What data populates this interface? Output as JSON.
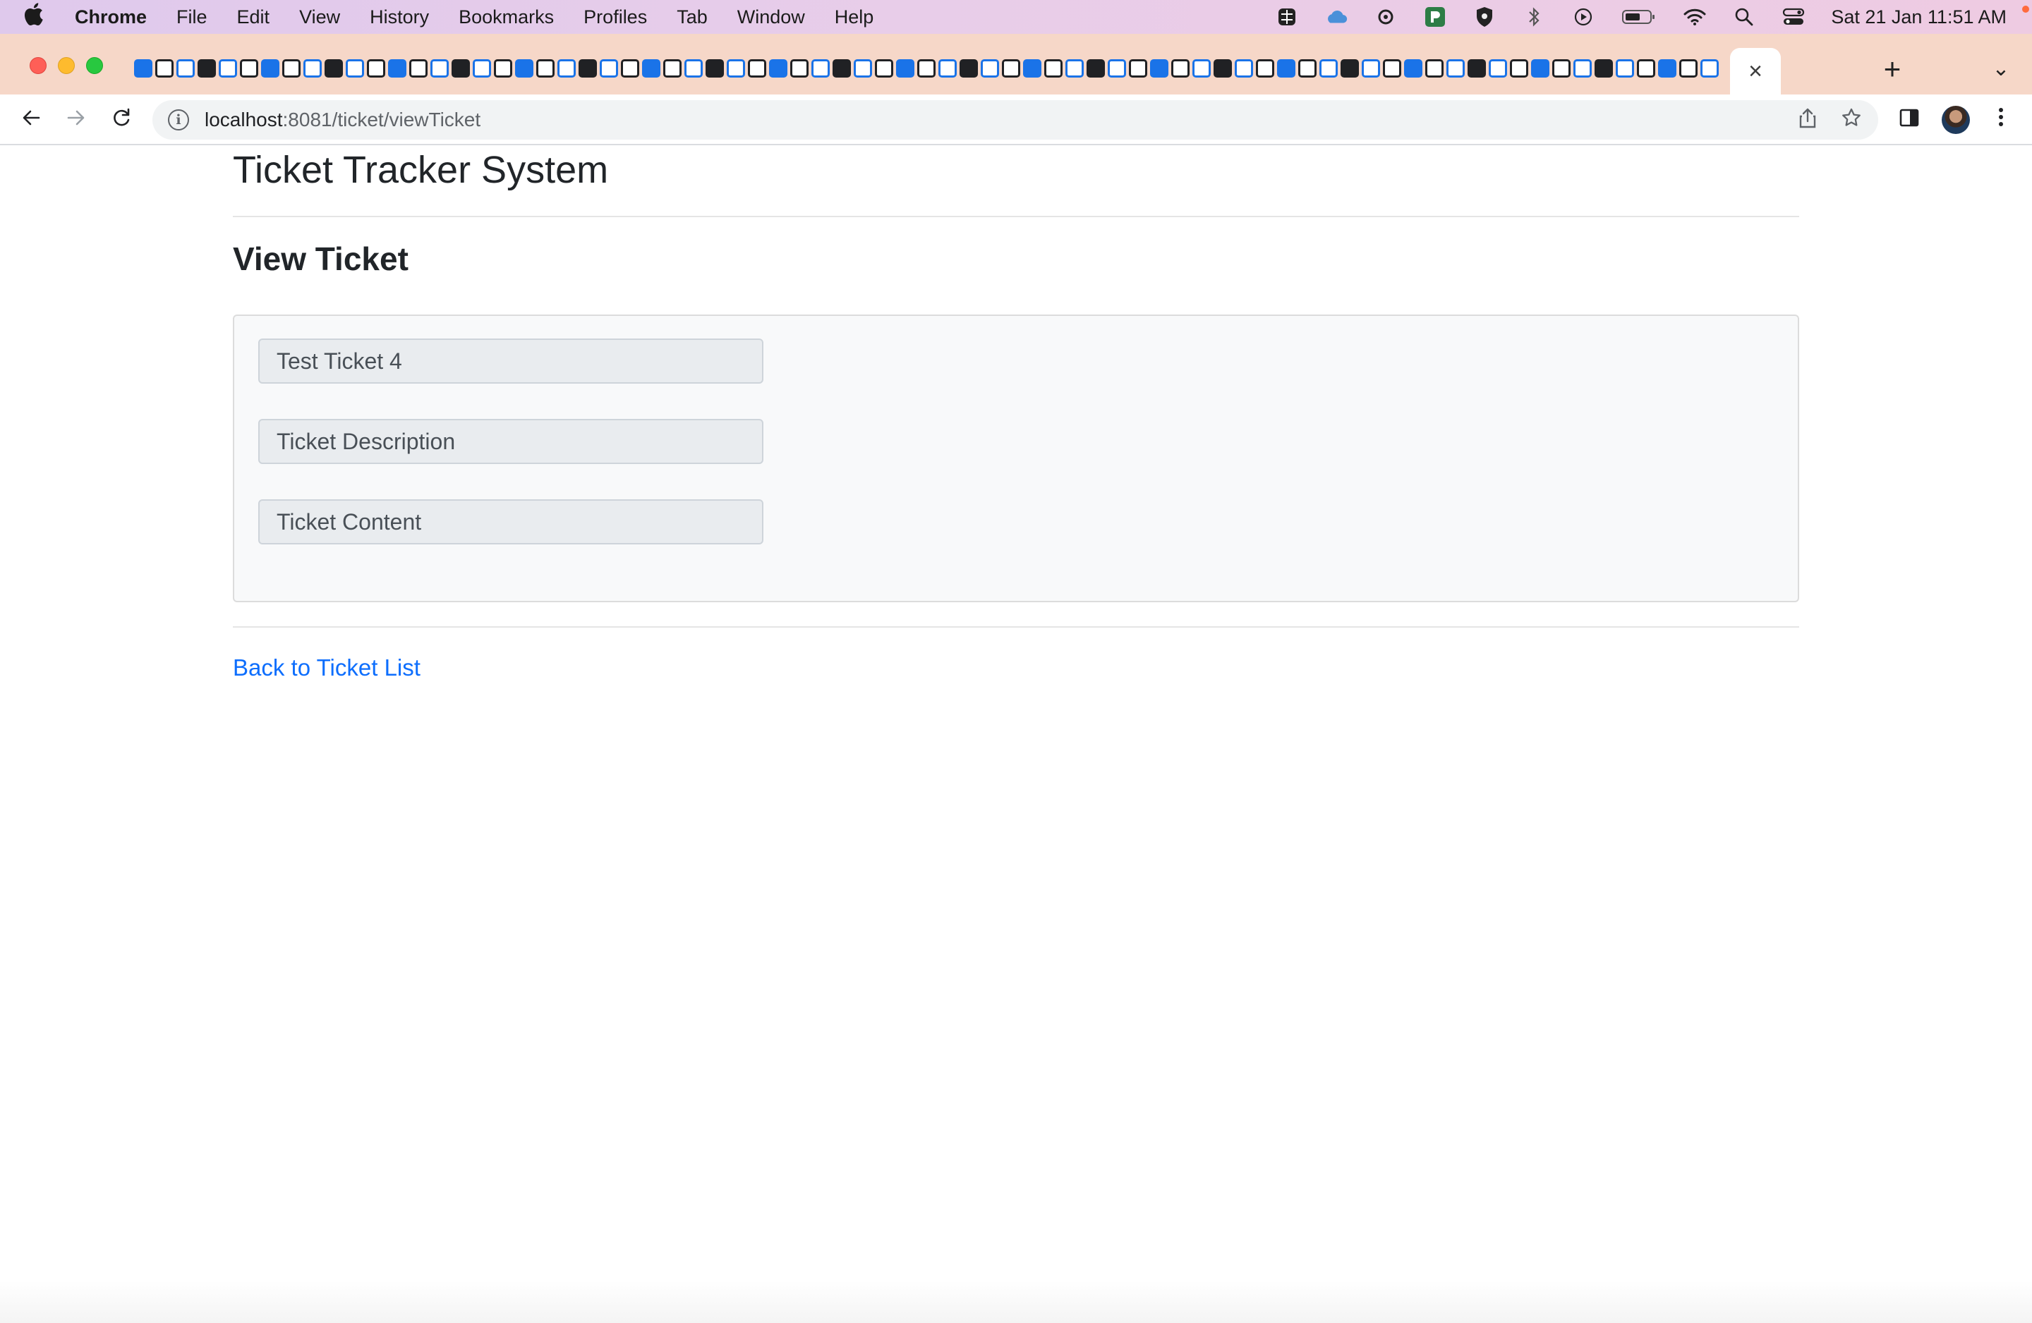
{
  "menubar": {
    "app_name": "Chrome",
    "menus": [
      "File",
      "Edit",
      "View",
      "History",
      "Bookmarks",
      "Profiles",
      "Tab",
      "Window",
      "Help"
    ],
    "clock": "Sat 21 Jan  11:51 AM"
  },
  "browser": {
    "active_tab_close": "×",
    "url_host": "localhost",
    "url_path": ":8081/ticket/viewTicket"
  },
  "page": {
    "site_title": "Ticket Tracker System",
    "section_title": "View Ticket",
    "fields": {
      "title_value": "Test Ticket 4",
      "description_value": "Ticket Description",
      "content_value": "Ticket Content"
    },
    "back_link": "Back to Ticket List"
  },
  "colors": {
    "link": "#0d6efd",
    "field_bg": "#e9ecef",
    "card_bg": "#f8f9fa",
    "tabstrip_bg": "#f6d7c8"
  }
}
